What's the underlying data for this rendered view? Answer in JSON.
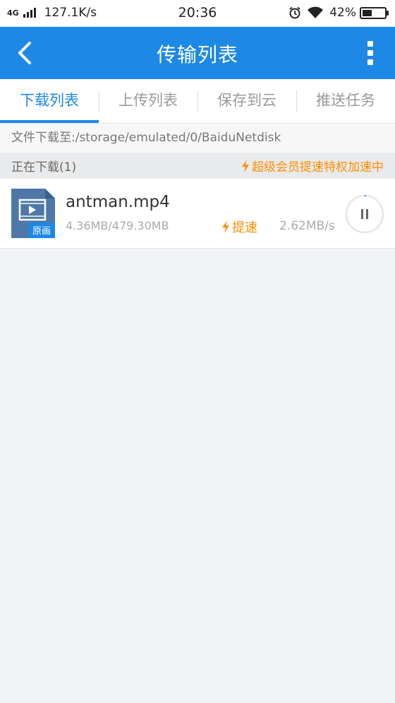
{
  "status_bar": {
    "network": "4G",
    "speed": "127.1K/s",
    "time": "20:36",
    "battery_percent": "42%",
    "battery_level": 0.42,
    "icons": [
      "signal-icon",
      "alarm-icon",
      "wifi-icon",
      "battery-icon"
    ]
  },
  "app_bar": {
    "title": "传输列表",
    "back_icon": "chevron-left-icon",
    "more_icon": "more-vertical-icon"
  },
  "tabs": [
    {
      "label": "下载列表",
      "active": true
    },
    {
      "label": "上传列表",
      "active": false
    },
    {
      "label": "保存到云",
      "active": false
    },
    {
      "label": "推送任务",
      "active": false
    }
  ],
  "download_path": "文件下载至:/storage/emulated/0/BaiduNetdisk",
  "section": {
    "label": "正在下载(1)",
    "promo": "超级会员提速特权加速中"
  },
  "downloads": [
    {
      "file_name": "antman.mp4",
      "thumb_badge": "原画",
      "size": "4.36MB/479.30MB",
      "boost_label": "提速",
      "rate": "2.62MB/s",
      "progress": 0.009,
      "action_icon": "pause-icon"
    }
  ],
  "colors": {
    "primary": "#1e88e5",
    "accent_orange": "#ff8f00",
    "background": "#f2f3f5"
  }
}
